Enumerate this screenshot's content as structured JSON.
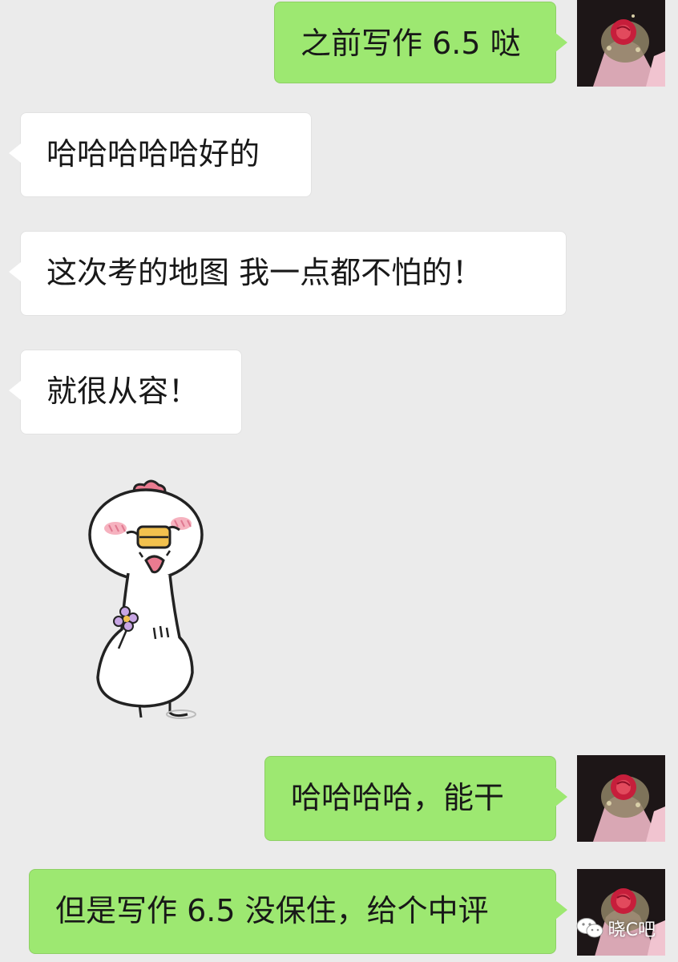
{
  "messages": [
    {
      "id": "m1",
      "direction": "outgoing",
      "text": "之前写作 6.5 哒"
    },
    {
      "id": "m2",
      "direction": "incoming",
      "text": "哈哈哈哈哈好的"
    },
    {
      "id": "m3",
      "direction": "incoming",
      "text": "这次考的地图 我一点都不怕的！"
    },
    {
      "id": "m4",
      "direction": "incoming",
      "text": "就很从容！"
    },
    {
      "id": "m5",
      "direction": "incoming",
      "type": "sticker",
      "sticker": "blushing-chick-with-flower"
    },
    {
      "id": "m6",
      "direction": "outgoing",
      "text": "哈哈哈哈，能干"
    },
    {
      "id": "m7",
      "direction": "outgoing",
      "text": "但是写作 6.5 没保住，给个中评"
    }
  ],
  "watermark": {
    "icon": "wechat-icon",
    "text": "晓C吧"
  },
  "colors": {
    "background": "#ebebeb",
    "outgoing_bubble": "#9de871",
    "incoming_bubble": "#ffffff",
    "text": "#181818"
  }
}
